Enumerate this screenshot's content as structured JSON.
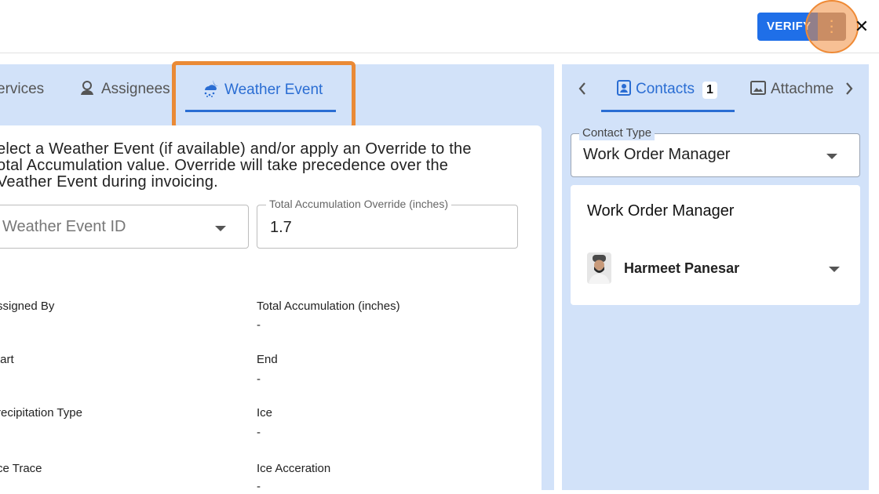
{
  "header": {
    "verify_label": "VERIFY",
    "more_icon": "more-vert-icon",
    "close_icon": "close-icon"
  },
  "left_tabs": [
    {
      "label": "ervices"
    },
    {
      "label": "Assignees",
      "icon": "person-icon"
    },
    {
      "label": "Weather Event",
      "icon": "weather-snow-icon",
      "active": true
    }
  ],
  "weather": {
    "instructions_line1": "elect a Weather Event (if available) and/or apply an Override to the",
    "instructions_line2": "otal Accumulation value. Override will take precedence over the",
    "instructions_line3": "Veather Event during invoicing.",
    "event_select_placeholder": "Weather Event ID",
    "override_label": "Total Accumulation Override (inches)",
    "override_value": "1.7",
    "fields": [
      {
        "label": "ssigned By",
        "value": ""
      },
      {
        "label": "Total Accumulation (inches)",
        "value": "-"
      },
      {
        "label": "tart",
        "value": ""
      },
      {
        "label": "End",
        "value": "-"
      },
      {
        "label": "recipitation Type",
        "value": ""
      },
      {
        "label": "Ice",
        "value": "-"
      },
      {
        "label": "ce Trace",
        "value": ""
      },
      {
        "label": "Ice Acceration",
        "value": "-"
      }
    ]
  },
  "right_tabs": {
    "contacts_label": "Contacts",
    "contacts_count": "1",
    "attachments_label": "Attachme"
  },
  "contacts": {
    "type_label": "Contact Type",
    "type_value": "Work Order Manager",
    "card_title": "Work Order Manager",
    "person_name": "Harmeet Panesar"
  },
  "colors": {
    "accent": "#2a6dd3",
    "panel": "#d2e2f9",
    "highlight": "#ea8a36",
    "verify": "#1f6fe8"
  }
}
